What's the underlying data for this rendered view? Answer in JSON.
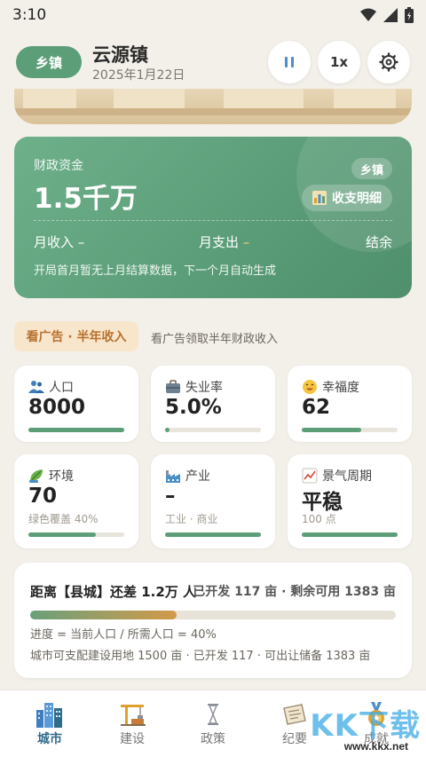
{
  "status_bar": {
    "time": "3:10"
  },
  "header": {
    "level_pill": "乡镇",
    "town_name": "云源镇",
    "date": "2025年1月22日",
    "speed_label": "1x"
  },
  "finance": {
    "label": "财政资金",
    "amount": "1.5千万",
    "level_tag": "乡镇",
    "detail_button": "收支明细",
    "monthly_income": "月收入 –",
    "monthly_expense": "月支出",
    "expense_dash": "–",
    "balance": "结余",
    "note": "开局首月暂无上月结算数据，下一个月自动生成"
  },
  "ad": {
    "pill": "看广告 · 半年收入",
    "text": "看广告领取半年财政收入"
  },
  "stats": [
    {
      "label": "人口",
      "value": "8000",
      "sub": "",
      "progress": 1.0
    },
    {
      "label": "失业率",
      "value": "5.0%",
      "sub": "",
      "progress": 0.05
    },
    {
      "label": "幸福度",
      "value": "62",
      "sub": "",
      "progress": 0.62
    },
    {
      "label": "环境",
      "value": "70",
      "sub": "绿色覆盖 40%",
      "progress": 0.7
    },
    {
      "label": "产业",
      "value": "–",
      "sub": "工业 · 商业",
      "progress": 1.0
    },
    {
      "label": "景气周期",
      "value": "平稳",
      "sub": "100 点",
      "progress": 1.0
    }
  ],
  "distance": {
    "title": "距离【县城】还差 1.2万 人",
    "right": "已开发 117 亩 · 剩余可用 1383 亩",
    "progress": 0.4,
    "progress_text": "进度 = 当前人口 / 所需人口 = 40%",
    "land_text": "城市可支配建设用地 1500 亩 · 已开发 117 · 可出让储备 1383 亩"
  },
  "tabs": [
    {
      "label": "城市",
      "active": true
    },
    {
      "label": "建设",
      "active": false
    },
    {
      "label": "政策",
      "active": false
    },
    {
      "label": "纪要",
      "active": false
    },
    {
      "label": "成就",
      "active": false
    }
  ],
  "watermark": {
    "text": "KK下载",
    "url": "www.kkx.net"
  },
  "colors": {
    "accent": "#5c9e78",
    "ad_bg": "#f8e6cc",
    "ad_text": "#b8712e",
    "tab_active": "#2f6b8a"
  }
}
